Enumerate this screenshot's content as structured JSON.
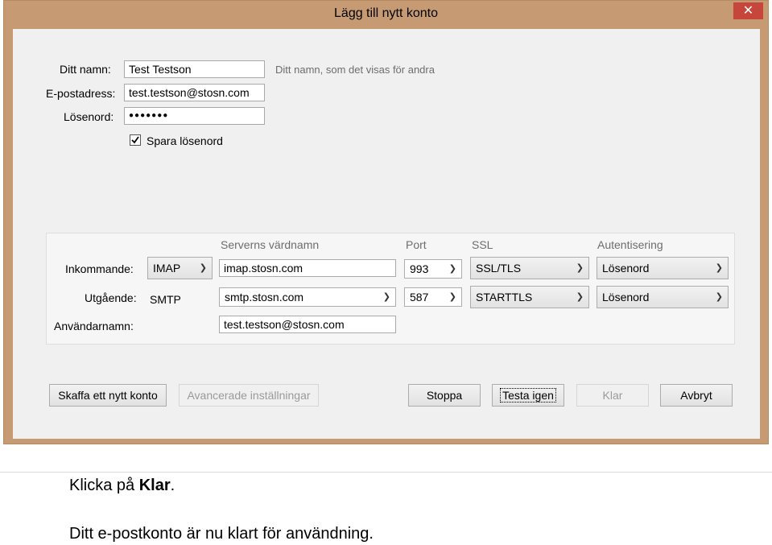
{
  "window": {
    "title": "Lägg till nytt konto",
    "close_glyph": "✕"
  },
  "form": {
    "name_label": "Ditt namn:",
    "name_value": "Test Testson",
    "name_hint": "Ditt namn, som det visas för andra",
    "email_label": "E-postadress:",
    "email_value": "test.testson@stosn.com",
    "password_label": "Lösenord:",
    "password_value": "●●●●●●●",
    "save_password_label": "Spara lösenord",
    "save_password_checked": true
  },
  "server": {
    "col_hostname": "Serverns värdnamn",
    "col_port": "Port",
    "col_ssl": "SSL",
    "col_auth": "Autentisering",
    "incoming_label": "Inkommande:",
    "incoming_protocol": "IMAP",
    "incoming_host": "imap.stosn.com",
    "incoming_port": "993",
    "incoming_ssl": "SSL/TLS",
    "incoming_auth": "Lösenord",
    "outgoing_label": "Utgående:",
    "outgoing_protocol": "SMTP",
    "outgoing_host": "smtp.stosn.com",
    "outgoing_port": "587",
    "outgoing_ssl": "STARTTLS",
    "outgoing_auth": "Lösenord",
    "username_label": "Användarnamn:",
    "username_value": "test.testson@stosn.com"
  },
  "buttons": {
    "get_new_account": "Skaffa ett nytt konto",
    "advanced": "Avancerade inställningar",
    "stop": "Stoppa",
    "retest": "Testa igen",
    "done": "Klar",
    "cancel": "Avbryt"
  },
  "caption": {
    "line1_prefix": "Klicka på ",
    "line1_bold": "Klar",
    "line1_suffix": ".",
    "line2": "Ditt e-postkonto är nu klart för användning."
  }
}
